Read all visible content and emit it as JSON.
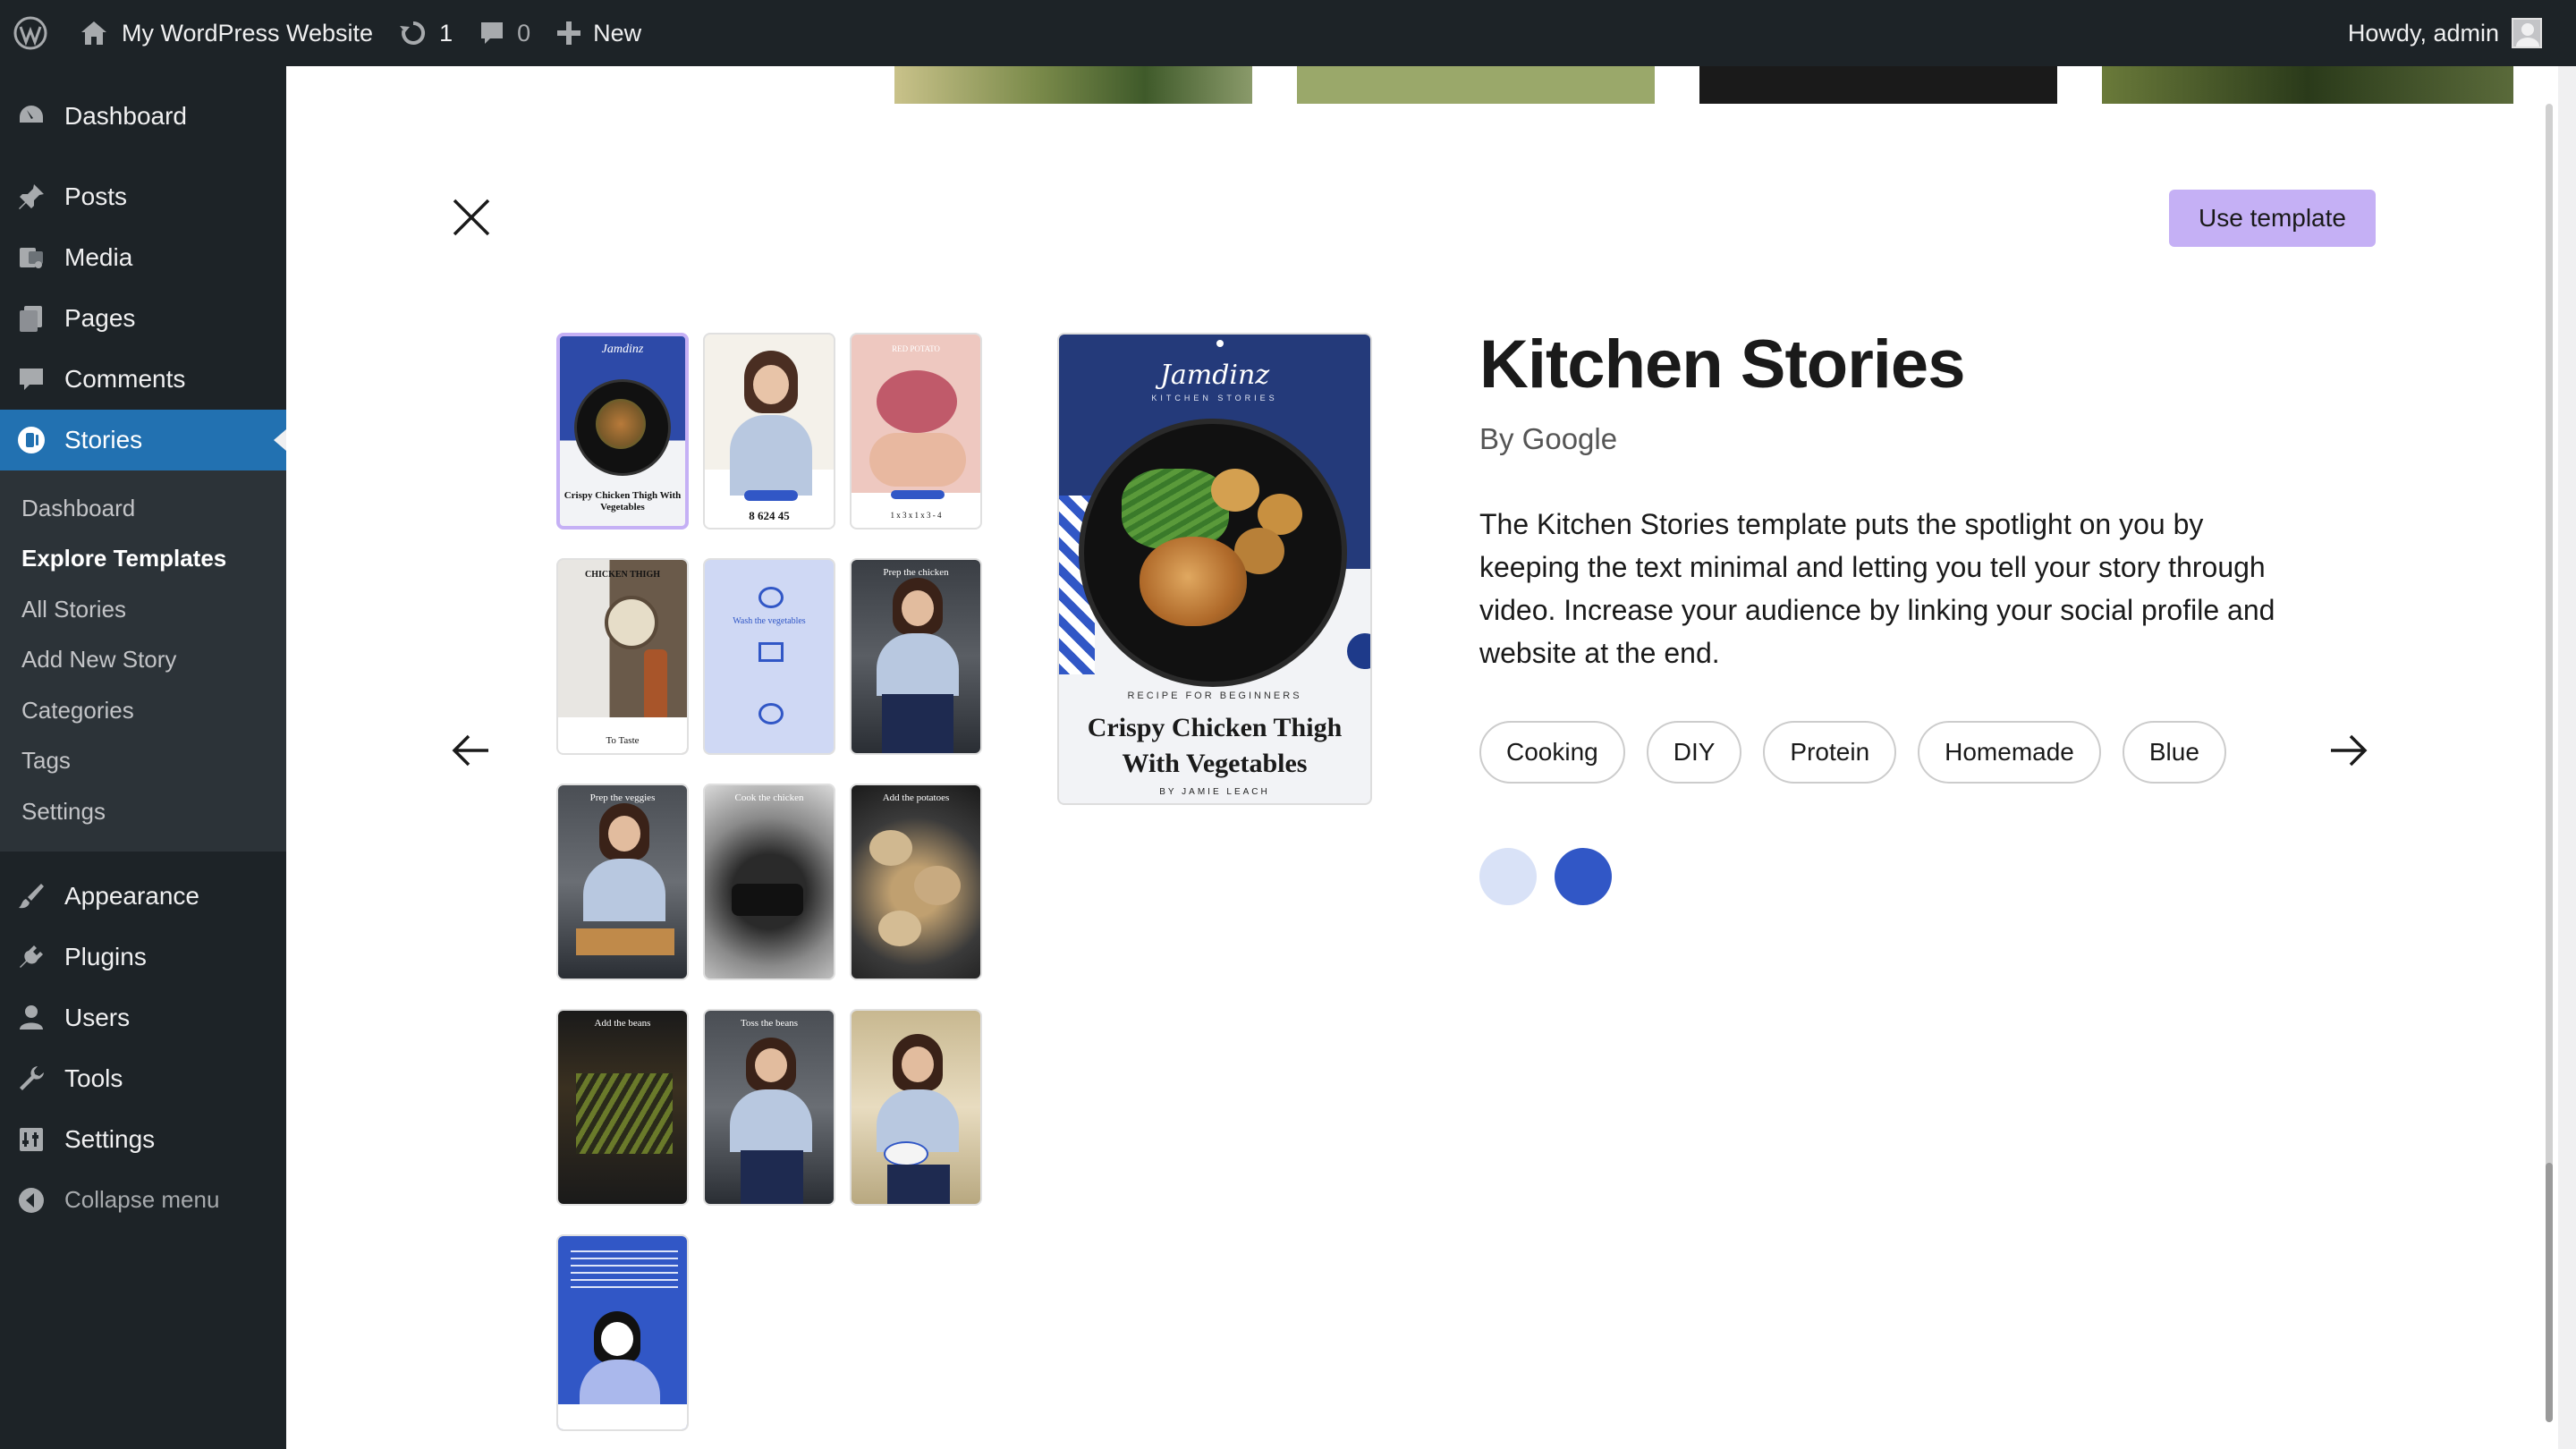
{
  "admin_bar": {
    "site_name": "My WordPress Website",
    "updates_count": "1",
    "comments_count": "0",
    "new_label": "New",
    "howdy": "Howdy, admin"
  },
  "sidebar": {
    "items_top": [
      {
        "label": "Dashboard",
        "icon": "dashboard-icon"
      },
      {
        "label": "Posts",
        "icon": "pin-icon"
      },
      {
        "label": "Media",
        "icon": "media-icon"
      },
      {
        "label": "Pages",
        "icon": "pages-icon"
      },
      {
        "label": "Comments",
        "icon": "comment-icon"
      },
      {
        "label": "Stories",
        "icon": "stories-icon"
      }
    ],
    "submenu": [
      "Dashboard",
      "Explore Templates",
      "All Stories",
      "Add New Story",
      "Categories",
      "Tags",
      "Settings"
    ],
    "items_bottom": [
      {
        "label": "Appearance",
        "icon": "brush-icon"
      },
      {
        "label": "Plugins",
        "icon": "plugin-icon"
      },
      {
        "label": "Users",
        "icon": "user-icon"
      },
      {
        "label": "Tools",
        "icon": "wrench-icon"
      },
      {
        "label": "Settings",
        "icon": "settings-icon"
      }
    ],
    "collapse_label": "Collapse menu"
  },
  "template": {
    "use_template_label": "Use template",
    "title": "Kitchen Stories",
    "byline": "By Google",
    "description": "The Kitchen Stories template puts the spotlight on you by keeping the text minimal and letting you tell your story through video. Increase your audience by linking your social profile and website at the end.",
    "tags": [
      "Cooking",
      "DIY",
      "Protein",
      "Homemade",
      "Blue"
    ],
    "colors": [
      "#d9e2f7",
      "#3157c6"
    ],
    "preview": {
      "brand": "Jamdinz",
      "brand_sub": "KITCHEN STORIES",
      "recipe_label": "RECIPE FOR BEGINNERS",
      "dish": "Crispy Chicken Thigh With Vegetables",
      "author": "BY JAMIE LEACH"
    },
    "thumbs": [
      {
        "label_top": "Jamdinz",
        "label_bottom": "Crispy Chicken Thigh With Vegetables"
      },
      {
        "label_top": "",
        "label_bottom": "8  624  45"
      },
      {
        "label_top": "RED POTATO",
        "label_bottom": "1 x  3 x  1 x  3 - 4"
      },
      {
        "label_top": "CHICKEN THIGH",
        "label_bottom": "To Taste"
      },
      {
        "label_top": "",
        "label_bottom": "Wash the vegetables"
      },
      {
        "label_top": "Prep the chicken",
        "label_bottom": ""
      },
      {
        "label_top": "Prep the veggies",
        "label_bottom": ""
      },
      {
        "label_top": "Cook the chicken",
        "label_bottom": ""
      },
      {
        "label_top": "Add the potatoes",
        "label_bottom": ""
      },
      {
        "label_top": "Add the beans",
        "label_bottom": ""
      },
      {
        "label_top": "Toss the beans",
        "label_bottom": ""
      },
      {
        "label_top": "",
        "label_bottom": ""
      },
      {
        "label_top": "",
        "label_bottom": ""
      }
    ]
  }
}
